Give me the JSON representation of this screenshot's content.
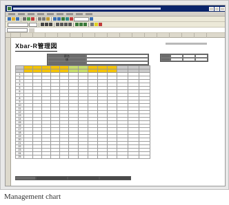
{
  "sheet": {
    "title": "Xbar-R管理図",
    "columns": [
      "",
      "",
      "",
      "",
      "",
      "",
      "",
      "",
      "",
      "",
      "",
      "",
      "",
      "",
      "",
      ""
    ],
    "rows": [
      "",
      "",
      "",
      "",
      "",
      "",
      "",
      "",
      "",
      "",
      "",
      "",
      "",
      "",
      "",
      "",
      "",
      "",
      "",
      "",
      "",
      "",
      "",
      "",
      "",
      "",
      "",
      "",
      "",
      "",
      "",
      "",
      "",
      "",
      "",
      "",
      "",
      ""
    ]
  },
  "info": {
    "rows": [
      {
        "label": "群名",
        "value": ""
      },
      {
        "label": "値",
        "value": ""
      },
      {
        "label": "",
        "value": ""
      }
    ]
  },
  "stats": {
    "rows": [
      {
        "label": "",
        "v1": "",
        "v2": "",
        "v3": ""
      },
      {
        "label": "",
        "v1": "",
        "v2": "",
        "v3": ""
      }
    ]
  },
  "table": {
    "headers": [
      "",
      "",
      "",
      "",
      "",
      "",
      "",
      "",
      "",
      "",
      "",
      "",
      "",
      ""
    ],
    "subheaders": [
      "",
      "",
      "",
      "",
      "",
      "",
      "",
      "",
      "",
      "",
      "",
      "",
      "",
      ""
    ],
    "rows": [
      {
        "n": "1",
        "cells": [
          "",
          "",
          "",
          "",
          "",
          "",
          "",
          "",
          "",
          "",
          "",
          "",
          ""
        ]
      },
      {
        "n": "2",
        "cells": [
          "",
          "",
          "",
          "",
          "",
          "",
          "",
          "",
          "",
          "",
          "",
          "",
          ""
        ]
      },
      {
        "n": "3",
        "cells": [
          "",
          "",
          "",
          "",
          "",
          "",
          "",
          "",
          "",
          "",
          "",
          "",
          ""
        ]
      },
      {
        "n": "4",
        "cells": [
          "",
          "",
          "",
          "",
          "",
          "",
          "",
          "",
          "",
          "",
          "",
          "",
          ""
        ]
      },
      {
        "n": "5",
        "cells": [
          "",
          "",
          "",
          "",
          "",
          "",
          "",
          "",
          "",
          "",
          "",
          "",
          ""
        ]
      },
      {
        "n": "6",
        "cells": [
          "",
          "",
          "",
          "",
          "",
          "",
          "",
          "",
          "",
          "",
          "",
          "",
          ""
        ]
      },
      {
        "n": "7",
        "cells": [
          "",
          "",
          "",
          "",
          "",
          "",
          "",
          "",
          "",
          "",
          "",
          "",
          ""
        ]
      },
      {
        "n": "8",
        "cells": [
          "",
          "",
          "",
          "",
          "",
          "",
          "",
          "",
          "",
          "",
          "",
          "",
          ""
        ]
      },
      {
        "n": "9",
        "cells": [
          "",
          "",
          "",
          "",
          "",
          "",
          "",
          "",
          "",
          "",
          "",
          "",
          ""
        ]
      },
      {
        "n": "10",
        "cells": [
          "",
          "",
          "",
          "",
          "",
          "",
          "",
          "",
          "",
          "",
          "",
          "",
          ""
        ]
      },
      {
        "n": "11",
        "cells": [
          "",
          "",
          "",
          "",
          "",
          "",
          "",
          "",
          "",
          "",
          "",
          "",
          ""
        ]
      },
      {
        "n": "12",
        "cells": [
          "",
          "",
          "",
          "",
          "",
          "",
          "",
          "",
          "",
          "",
          "",
          "",
          ""
        ]
      },
      {
        "n": "13",
        "cells": [
          "",
          "",
          "",
          "",
          "",
          "",
          "",
          "",
          "",
          "",
          "",
          "",
          ""
        ]
      },
      {
        "n": "14",
        "cells": [
          "",
          "",
          "",
          "",
          "",
          "",
          "",
          "",
          "",
          "",
          "",
          "",
          ""
        ]
      },
      {
        "n": "15",
        "cells": [
          "",
          "",
          "",
          "",
          "",
          "",
          "",
          "",
          "",
          "",
          "",
          "",
          ""
        ]
      },
      {
        "n": "16",
        "cells": [
          "",
          "",
          "",
          "",
          "",
          "",
          "",
          "",
          "",
          "",
          "",
          "",
          ""
        ]
      },
      {
        "n": "17",
        "cells": [
          "",
          "",
          "",
          "",
          "",
          "",
          "",
          "",
          "",
          "",
          "",
          "",
          ""
        ]
      },
      {
        "n": "18",
        "cells": [
          "",
          "",
          "",
          "",
          "",
          "",
          "",
          "",
          "",
          "",
          "",
          "",
          ""
        ]
      },
      {
        "n": "19",
        "cells": [
          "",
          "",
          "",
          "",
          "",
          "",
          "",
          "",
          "",
          "",
          "",
          "",
          ""
        ]
      },
      {
        "n": "20",
        "cells": [
          "",
          "",
          "",
          "",
          "",
          "",
          "",
          "",
          "",
          "",
          "",
          "",
          ""
        ]
      },
      {
        "n": "21",
        "cells": [
          "",
          "",
          "",
          "",
          "",
          "",
          "",
          "",
          "",
          "",
          "",
          "",
          ""
        ]
      },
      {
        "n": "22",
        "cells": [
          "",
          "",
          "",
          "",
          "",
          "",
          "",
          "",
          "",
          "",
          "",
          "",
          ""
        ]
      },
      {
        "n": "23",
        "cells": [
          "",
          "",
          "",
          "",
          "",
          "",
          "",
          "",
          "",
          "",
          "",
          "",
          ""
        ]
      },
      {
        "n": "24",
        "cells": [
          "",
          "",
          "",
          "",
          "",
          "",
          "",
          "",
          "",
          "",
          "",
          "",
          ""
        ]
      },
      {
        "n": "25",
        "cells": [
          "",
          "",
          "",
          "",
          "",
          "",
          "",
          "",
          "",
          "",
          "",
          "",
          ""
        ]
      }
    ]
  },
  "caption": "Management chart",
  "colors": {
    "header_yellow": "#f2c200",
    "header_green": "#c6dc6a",
    "dark_fill": "#6b6b6b",
    "titlebar": "#0a246a"
  }
}
